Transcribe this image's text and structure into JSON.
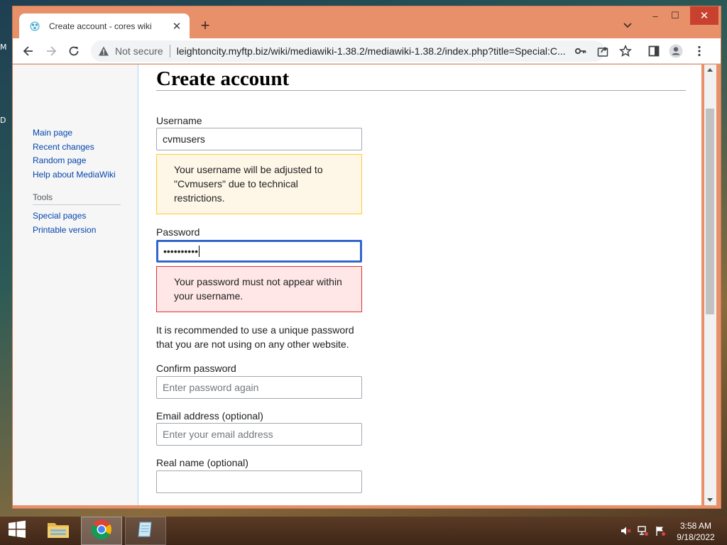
{
  "desktop": {
    "edge_letters": [
      "M",
      "D"
    ]
  },
  "browser": {
    "tab_title": "Create account - cores wiki",
    "tab_close": "✕",
    "new_tab": "+",
    "window_controls": {
      "minimize": "–",
      "maximize": "☐",
      "close": "✕"
    },
    "security_label": "Not secure",
    "url": "leightoncity.myftp.biz/wiki/mediawiki-1.38.2/mediawiki-1.38.2/index.php?title=Special:C..."
  },
  "sidebar": {
    "navigation": [
      {
        "label": "Main page"
      },
      {
        "label": "Recent changes"
      },
      {
        "label": "Random page"
      },
      {
        "label": "Help about MediaWiki"
      }
    ],
    "tools_heading": "Tools",
    "tools": [
      {
        "label": "Special pages"
      },
      {
        "label": "Printable version"
      }
    ]
  },
  "form": {
    "title": "Create account",
    "username_label": "Username",
    "username_value": "cvmusers",
    "username_warning": "Your username will be adjusted to \"Cvmusers\" due to technical restrictions.",
    "password_label": "Password",
    "password_value": "••••••••••",
    "password_error": "Your password must not appear within your username.",
    "password_note": "It is recommended to use a unique password that you are not using on any other website.",
    "confirm_label": "Confirm password",
    "confirm_placeholder": "Enter password again",
    "email_label": "Email address (optional)",
    "email_placeholder": "Enter your email address",
    "realname_label": "Real name (optional)",
    "realname_value": ""
  },
  "taskbar": {
    "time": "3:58 AM",
    "date": "9/18/2022"
  },
  "colors": {
    "window_frame": "#e8906a",
    "link": "#0645ad",
    "warning_bg": "#fef6e7",
    "warning_border": "#ffcc33",
    "error_bg": "#fee7e6",
    "error_border": "#dd3333",
    "focus_border": "#3366cc"
  }
}
